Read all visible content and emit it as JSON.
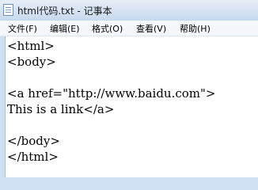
{
  "window": {
    "title": "html代码.txt - 记事本",
    "icon": "notepad-icon"
  },
  "menubar": {
    "items": [
      "文件(F)",
      "编辑(E)",
      "格式(O)",
      "查看(V)",
      "帮助(H)"
    ]
  },
  "editor": {
    "lines": [
      "<html>",
      "<body>",
      "",
      "<a href=\"http://www.baidu.com\">",
      "This is a link</a>",
      "",
      "</body>",
      "</html>"
    ]
  }
}
